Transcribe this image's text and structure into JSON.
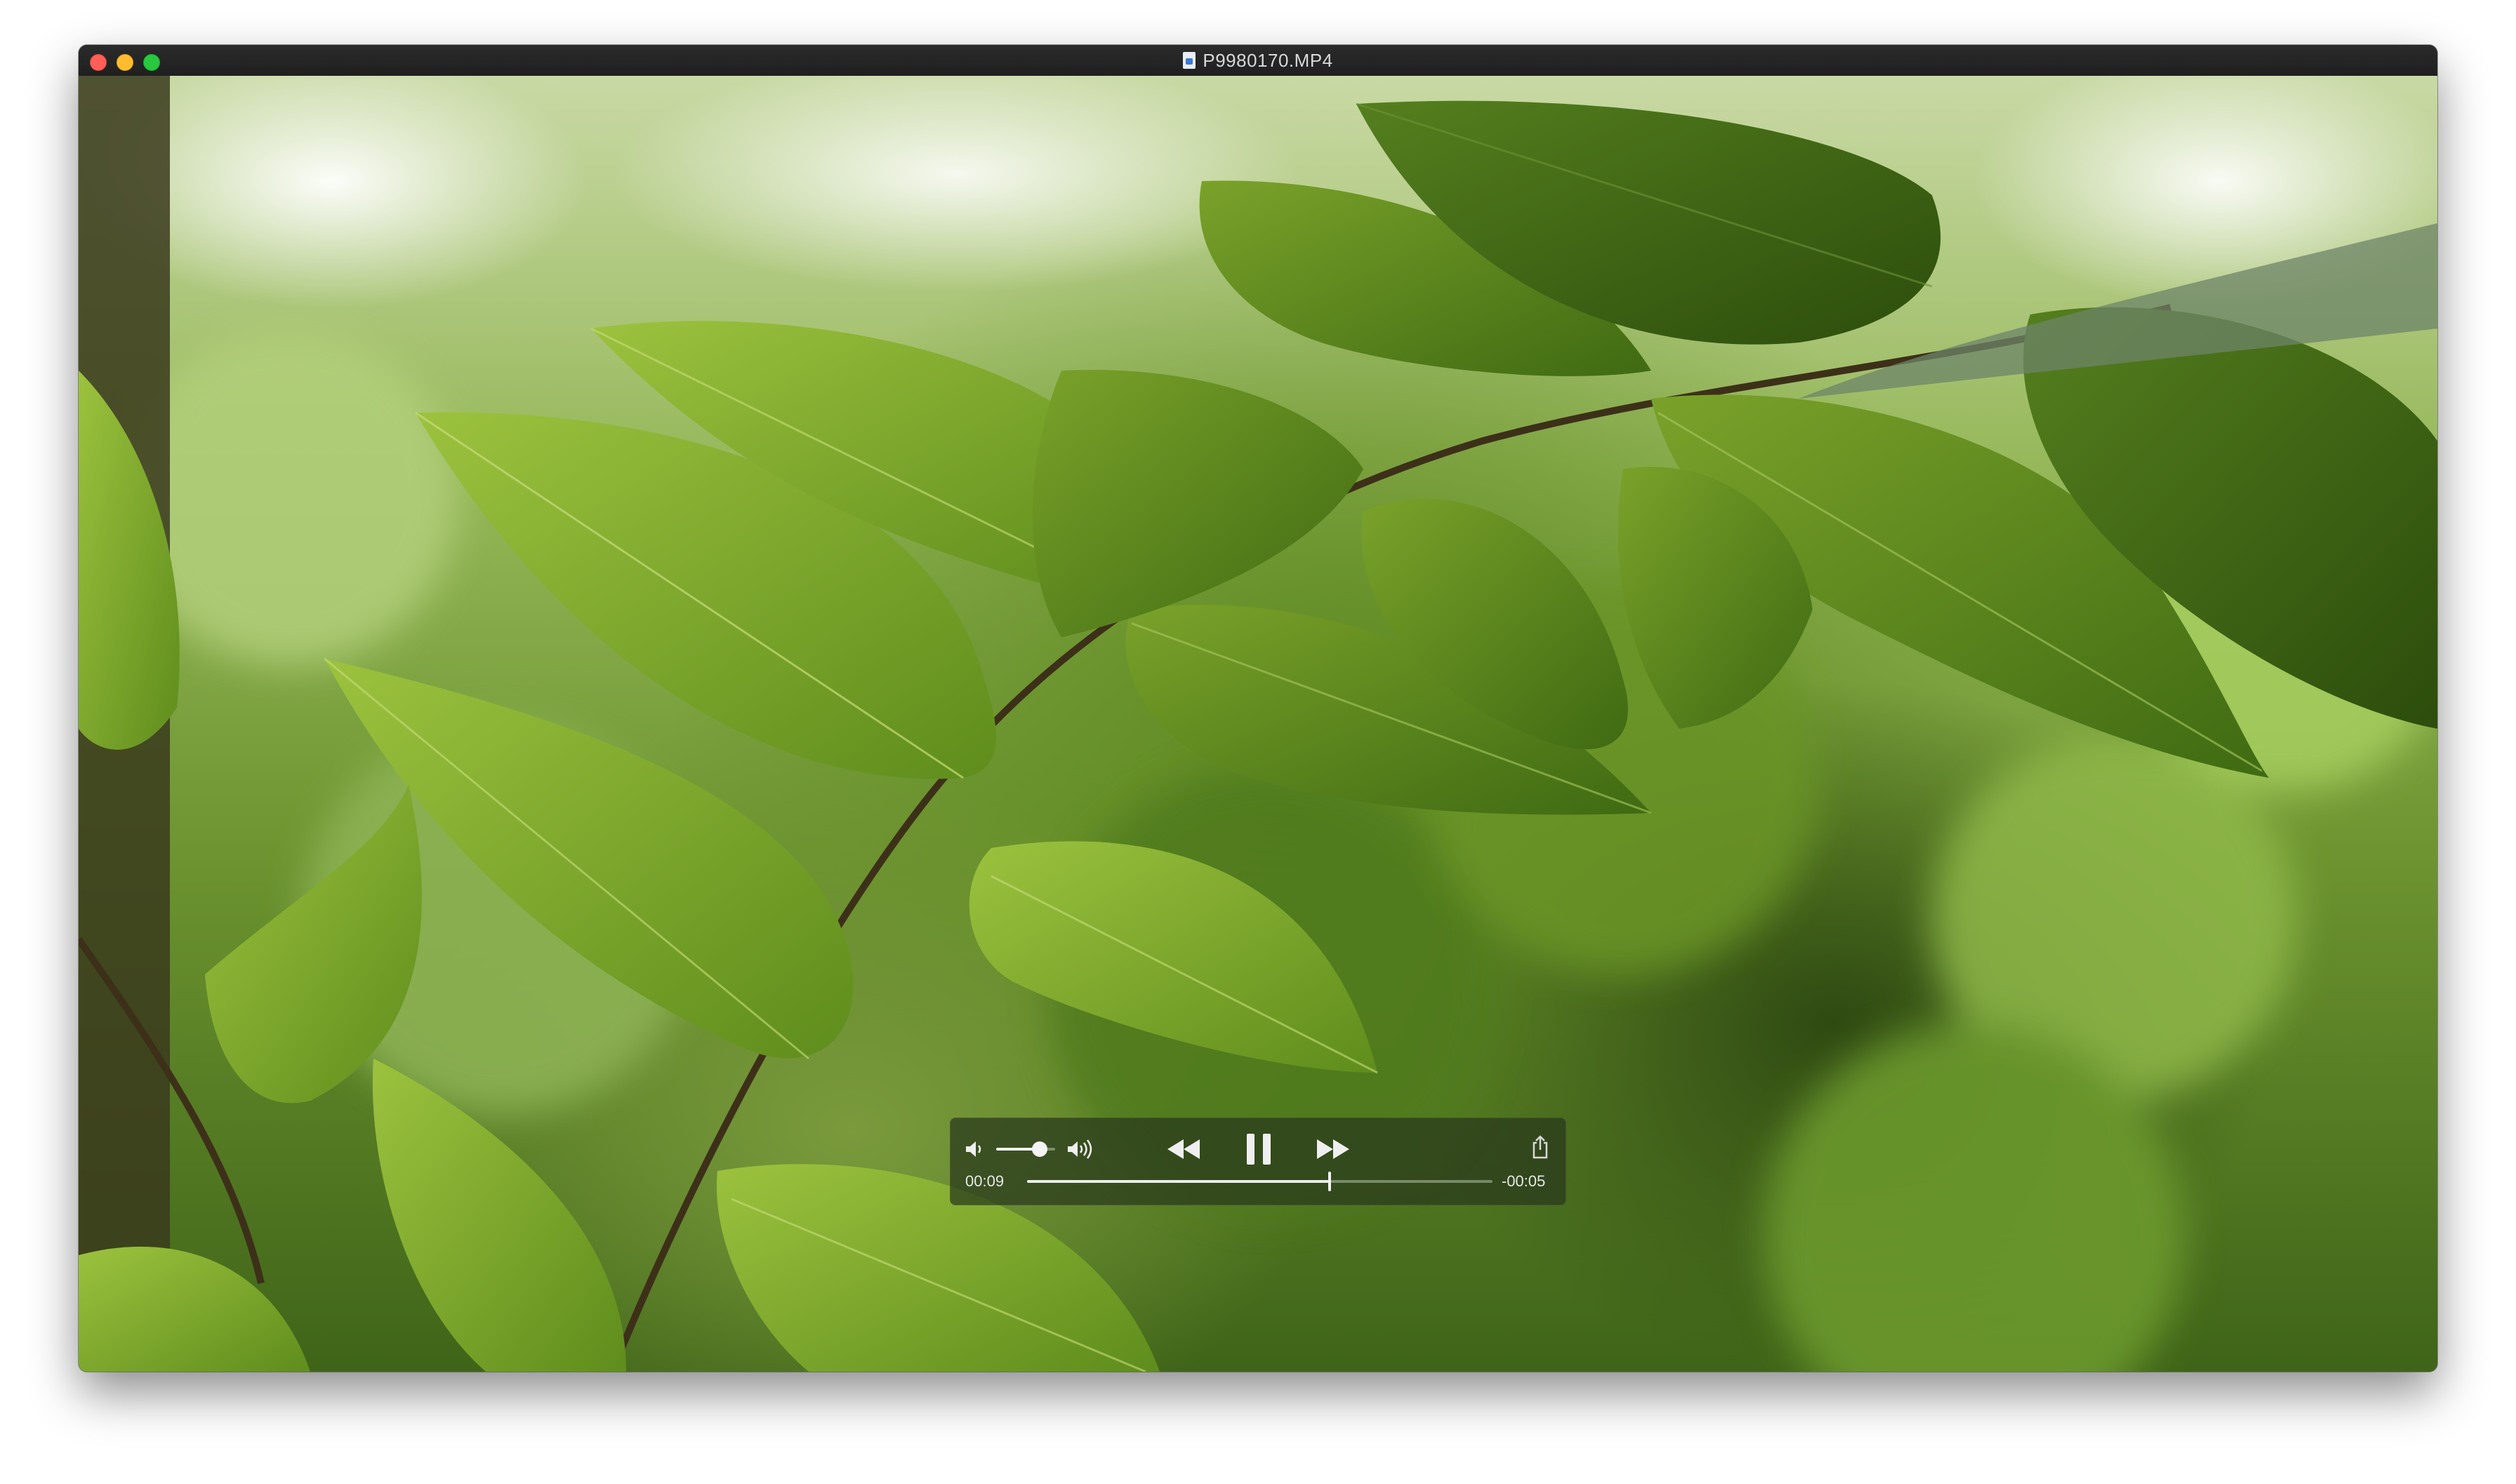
{
  "window": {
    "title": "P9980170.MP4",
    "buttons": {
      "close": "close-button",
      "minimize": "minimize-button",
      "zoom": "zoom-button"
    }
  },
  "player": {
    "elapsed": "00:09",
    "remaining": "-00:05",
    "progress_fraction": 0.65,
    "volume_fraction": 0.74,
    "state": "playing"
  },
  "icons": {
    "file": "video-file-icon",
    "mute": "volume-low-icon",
    "volume_max": "volume-high-icon",
    "rewind": "rewind-icon",
    "pause": "pause-icon",
    "forward": "fast-forward-icon",
    "share": "share-icon"
  },
  "colors": {
    "titlebar": "#2b2b2b",
    "close": "#ff5f57",
    "minimize": "#ffbd2e",
    "zoom": "#28c940",
    "hud_background": "#28381c"
  }
}
